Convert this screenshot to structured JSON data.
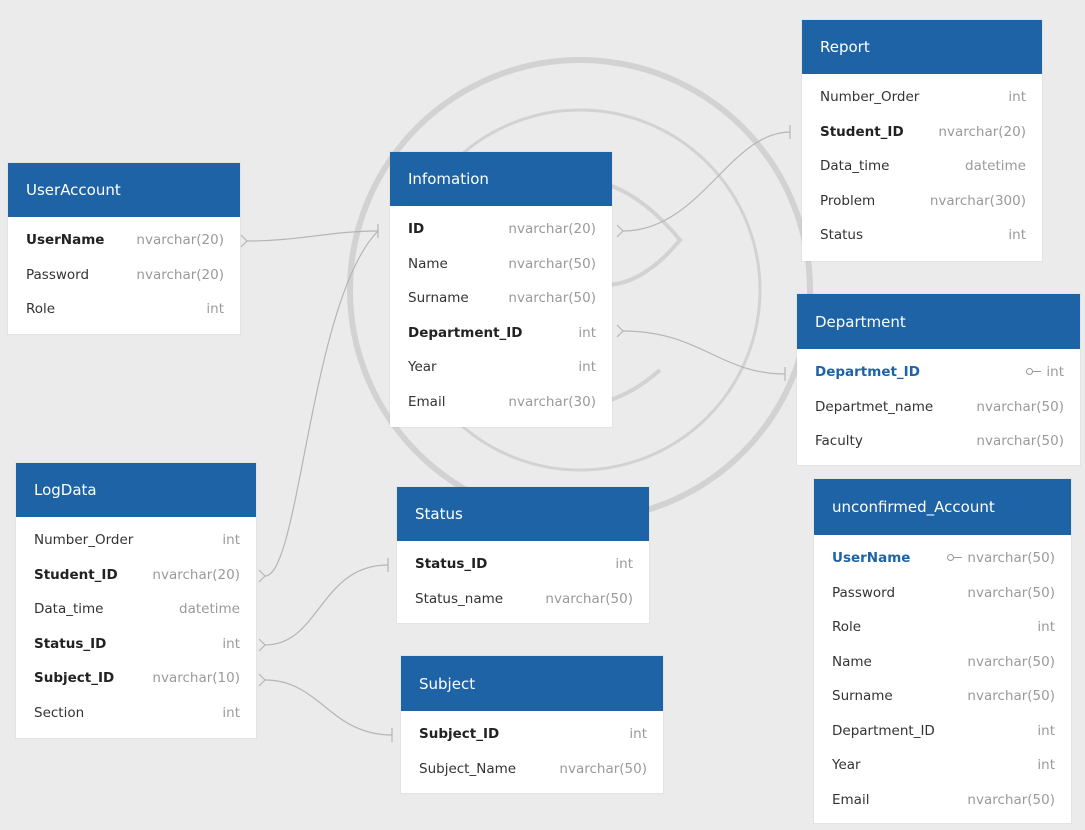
{
  "diagram": {
    "tables": [
      {
        "id": "report",
        "title": "Report",
        "fields": [
          {
            "name": "Number_Order",
            "type": "int",
            "style": "normal"
          },
          {
            "name": "Student_ID",
            "type": "nvarchar(20)",
            "style": "bold"
          },
          {
            "name": "Data_time",
            "type": "datetime",
            "style": "normal"
          },
          {
            "name": "Problem",
            "type": "nvarchar(300)",
            "style": "normal"
          },
          {
            "name": "Status",
            "type": "int",
            "style": "normal"
          }
        ]
      },
      {
        "id": "useraccount",
        "title": "UserAccount",
        "fields": [
          {
            "name": "UserName",
            "type": "nvarchar(20)",
            "style": "bold"
          },
          {
            "name": "Password",
            "type": "nvarchar(20)",
            "style": "normal"
          },
          {
            "name": "Role",
            "type": "int",
            "style": "normal"
          }
        ]
      },
      {
        "id": "infomation",
        "title": "Infomation",
        "fields": [
          {
            "name": "ID",
            "type": "nvarchar(20)",
            "style": "bold"
          },
          {
            "name": "Name",
            "type": "nvarchar(50)",
            "style": "normal"
          },
          {
            "name": "Surname",
            "type": "nvarchar(50)",
            "style": "normal"
          },
          {
            "name": "Department_ID",
            "type": "int",
            "style": "bold"
          },
          {
            "name": "Year",
            "type": "int",
            "style": "normal"
          },
          {
            "name": "Email",
            "type": "nvarchar(30)",
            "style": "normal"
          }
        ]
      },
      {
        "id": "department",
        "title": "Department",
        "fields": [
          {
            "name": "Departmet_ID",
            "type": "int",
            "style": "pk"
          },
          {
            "name": "Departmet_name",
            "type": "nvarchar(50)",
            "style": "normal"
          },
          {
            "name": "Faculty",
            "type": "nvarchar(50)",
            "style": "normal"
          }
        ]
      },
      {
        "id": "logdata",
        "title": "LogData",
        "fields": [
          {
            "name": "Number_Order",
            "type": "int",
            "style": "normal"
          },
          {
            "name": "Student_ID",
            "type": "nvarchar(20)",
            "style": "bold"
          },
          {
            "name": "Data_time",
            "type": "datetime",
            "style": "normal"
          },
          {
            "name": "Status_ID",
            "type": "int",
            "style": "bold"
          },
          {
            "name": "Subject_ID",
            "type": "nvarchar(10)",
            "style": "bold"
          },
          {
            "name": "Section",
            "type": "int",
            "style": "normal"
          }
        ]
      },
      {
        "id": "status",
        "title": "Status",
        "fields": [
          {
            "name": "Status_ID",
            "type": "int",
            "style": "bold"
          },
          {
            "name": "Status_name",
            "type": "nvarchar(50)",
            "style": "normal"
          }
        ]
      },
      {
        "id": "subject",
        "title": "Subject",
        "fields": [
          {
            "name": "Subject_ID",
            "type": "int",
            "style": "bold"
          },
          {
            "name": "Subject_Name",
            "type": "nvarchar(50)",
            "style": "normal"
          }
        ]
      },
      {
        "id": "unconfirmed",
        "title": "unconfirmed_Account",
        "fields": [
          {
            "name": "UserName",
            "type": "nvarchar(50)",
            "style": "pk"
          },
          {
            "name": "Password",
            "type": "nvarchar(50)",
            "style": "normal"
          },
          {
            "name": "Role",
            "type": "int",
            "style": "normal"
          },
          {
            "name": "Name",
            "type": "nvarchar(50)",
            "style": "normal"
          },
          {
            "name": "Surname",
            "type": "nvarchar(50)",
            "style": "normal"
          },
          {
            "name": "Department_ID",
            "type": "int",
            "style": "normal"
          },
          {
            "name": "Year",
            "type": "int",
            "style": "normal"
          },
          {
            "name": "Email",
            "type": "nvarchar(50)",
            "style": "normal"
          }
        ]
      }
    ],
    "relationships": [
      {
        "from": "useraccount.UserName",
        "to": "infomation.ID"
      },
      {
        "from": "infomation.ID",
        "to": "report.Student_ID"
      },
      {
        "from": "infomation.Department_ID",
        "to": "department.Departmet_ID"
      },
      {
        "from": "logdata.Student_ID",
        "to": "infomation.ID"
      },
      {
        "from": "logdata.Status_ID",
        "to": "status.Status_ID"
      },
      {
        "from": "logdata.Subject_ID",
        "to": "subject.Subject_ID"
      }
    ],
    "colors": {
      "header": "#1e63a5",
      "canvas": "#ebebeb",
      "connector": "#b5b5b5"
    }
  }
}
